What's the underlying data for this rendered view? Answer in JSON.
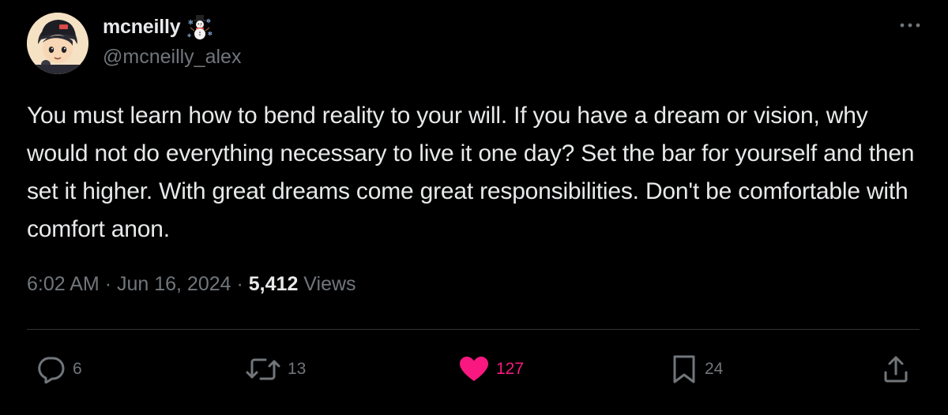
{
  "author": {
    "display_name": "mcneilly",
    "handle": "@mcneilly_alex",
    "name_emoji": "snowman-icon"
  },
  "tweet": {
    "text": "You must learn how to bend reality to your will. If you have a dream or vision, why would not do everything necessary to live it one day? Set the bar for yourself and then set it higher. With great dreams come great responsibilities. Don't be comfortable with comfort anon.",
    "time": "6:02 AM",
    "separator": "·",
    "date": "Jun 16, 2024",
    "views_count": "5,412",
    "views_label": "Views"
  },
  "actions": {
    "replies": "6",
    "reposts": "13",
    "likes": "127",
    "bookmarks": "24",
    "liked": true
  },
  "colors": {
    "background": "#000000",
    "text_primary": "#e7e9ea",
    "text_secondary": "#71767b",
    "like_active": "#f91880",
    "divider": "#2f3336"
  }
}
